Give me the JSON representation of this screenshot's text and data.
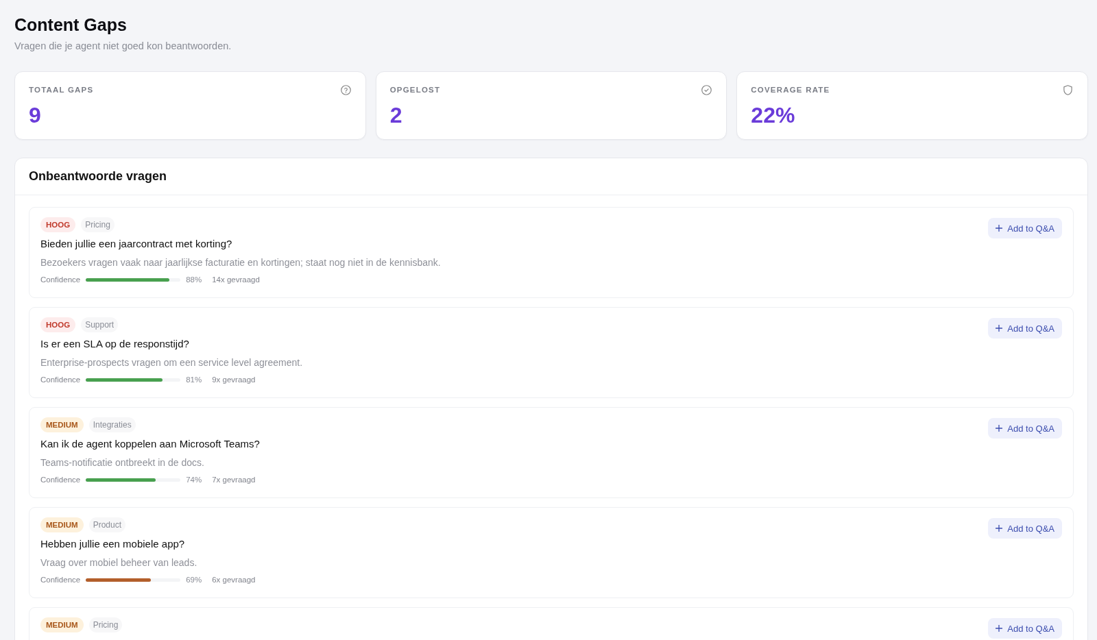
{
  "page": {
    "title": "Content Gaps",
    "subtitle": "Vragen die je agent niet goed kon beantwoorden."
  },
  "stats": [
    {
      "label": "TOTAAL GAPS",
      "value": "9"
    },
    {
      "label": "OPGELOST",
      "value": "2"
    },
    {
      "label": "COVERAGE RATE",
      "value": "22%"
    }
  ],
  "panel": {
    "title": "Onbeantwoorde vragen",
    "items": [
      {
        "priority": {
          "text": "HOOG",
          "kind": "high"
        },
        "category": "Pricing",
        "question": "Bieden jullie een jaarcontract met korting?",
        "description": "Bezoekers vragen vaak naar jaarlijkse facturatie en kortingen; staat nog niet in de kennisbank.",
        "confidence_label": "Confidence",
        "confidence": {
          "level": 0.88,
          "reading": "88%",
          "color": "#48a04f"
        },
        "asked": "14x gevraagd",
        "button": "Add to Q&A"
      },
      {
        "priority": {
          "text": "HOOG",
          "kind": "high"
        },
        "category": "Support",
        "question": "Is er een SLA op de responstijd?",
        "description": "Enterprise-prospects vragen om een service level agreement.",
        "confidence_label": "Confidence",
        "confidence": {
          "level": 0.81,
          "reading": "81%",
          "color": "#48a04f"
        },
        "asked": "9x gevraagd",
        "button": "Add to Q&A"
      },
      {
        "priority": {
          "text": "MEDIUM",
          "kind": "medium"
        },
        "category": "Integraties",
        "question": "Kan ik de agent koppelen aan Microsoft Teams?",
        "description": "Teams-notificatie ontbreekt in de docs.",
        "confidence_label": "Confidence",
        "confidence": {
          "level": 0.74,
          "reading": "74%",
          "color": "#48a04f"
        },
        "asked": "7x gevraagd",
        "button": "Add to Q&A"
      },
      {
        "priority": {
          "text": "MEDIUM",
          "kind": "medium"
        },
        "category": "Product",
        "question": "Hebben jullie een mobiele app?",
        "description": "Vraag over mobiel beheer van leads.",
        "confidence_label": "Confidence",
        "confidence": {
          "level": 0.69,
          "reading": "69%",
          "color": "#b35f2b"
        },
        "asked": "6x gevraagd",
        "button": "Add to Q&A"
      },
      {
        "priority": {
          "text": "MEDIUM",
          "kind": "medium"
        },
        "category": "Pricing",
        "button": "Add to Q&A"
      }
    ]
  }
}
